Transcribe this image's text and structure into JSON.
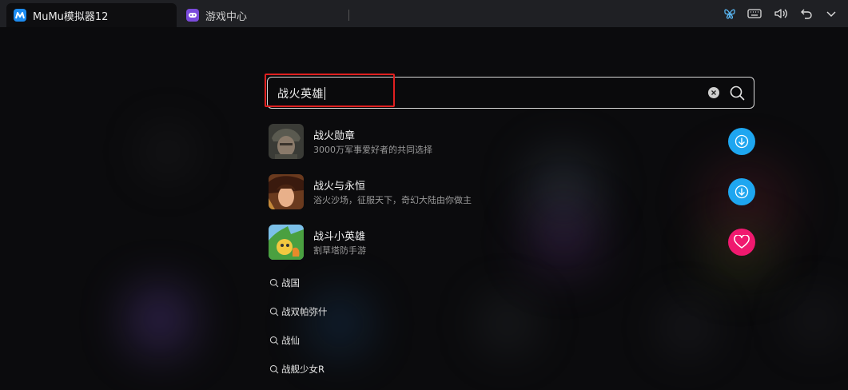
{
  "titlebar": {
    "tabs": [
      {
        "label": "MuMu模拟器12",
        "icon": "mumu-logo-icon",
        "active": true
      },
      {
        "label": "游戏中心",
        "icon": "gamepad-icon",
        "active": false
      }
    ],
    "controls": [
      "butterfly-icon",
      "keyboard-icon",
      "volume-icon",
      "back-icon",
      "chevron-down-icon"
    ]
  },
  "search": {
    "query": "战火英雄",
    "highlight_color": "#e02020"
  },
  "results": [
    {
      "name": "战火勋章",
      "desc": "3000万军事爱好者的共同选择",
      "action": "download",
      "action_color": "#1ea6f0"
    },
    {
      "name": "战火与永恒",
      "desc": "浴火沙场，征服天下，奇幻大陆由你做主",
      "action": "download",
      "action_color": "#1ea6f0"
    },
    {
      "name": "战斗小英雄",
      "desc": "割草塔防手游",
      "action": "favorite",
      "action_color": "#f0196f"
    }
  ],
  "suggestions": [
    "战国",
    "战双帕弥什",
    "战仙",
    "战舰少女R"
  ]
}
